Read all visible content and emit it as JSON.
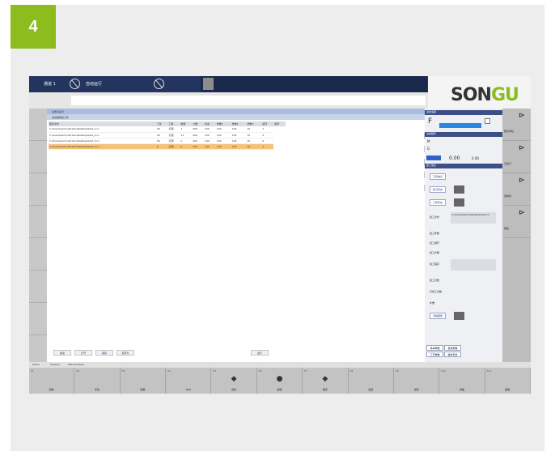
{
  "step": {
    "number": "4"
  },
  "topbar": {
    "channel": "通道 1",
    "mode": "自动运行"
  },
  "logo": {
    "text_main": "SON",
    "text_accent": "GU"
  },
  "panel": {
    "title": "注册表运行",
    "subtitle": "在线编辑加工件"
  },
  "table": {
    "headers": [
      "程序文件",
      "工件",
      "刀具",
      "数量",
      "计数",
      "状态",
      "参数1",
      "参数2",
      "参数3",
      "循环",
      "编号"
    ],
    "rows": [
      [
        "C:\\Users\\administrator\\Desktop\\test_1.nc",
        "36",
        "打磨",
        "1",
        "400",
        "100",
        "100",
        "100",
        "10",
        "1"
      ],
      [
        "C:\\Users\\administrator\\Desktop\\test_2.nc",
        "36",
        "打磨",
        "11",
        "400",
        "100",
        "100",
        "100",
        "10",
        "0"
      ],
      [
        "C:\\Users\\administrator\\Desktop\\test_3.nc",
        "36",
        "打磨",
        "0",
        "400",
        "100",
        "100",
        "100",
        "10",
        "0"
      ],
      [
        "C:\\Users\\administrator\\Desktop\\test_4.nc",
        "6",
        "打磨",
        "0",
        "400",
        "100",
        "100",
        "100",
        "10",
        "1"
      ]
    ]
  },
  "side_buttons": [
    "加载",
    "删除",
    "编辑",
    "上移",
    "下移"
  ],
  "bottom_buttons": [
    "新建",
    "打开",
    "保存",
    "另存为",
    "运行"
  ],
  "right_panel": {
    "header_a": "进给速度",
    "header_b": "当前程序",
    "header_c": "加工信息",
    "feed_letter": "F",
    "axis_m": "M",
    "axis_g": "G",
    "value_a": "0.00",
    "value_b": "0.00",
    "buttons": [
      "刀具信息",
      "换刀状态",
      "工件状态",
      "清除报警"
    ],
    "fields": [
      "加工文件",
      "加工件数",
      "加工循环",
      "加工步骤",
      "加工程序",
      "加工次数",
      "已加工次数",
      "补偿"
    ],
    "file_value": "C:\\Users\\admin\\Desktop\\test.nc",
    "tabs": [
      "基本参数",
      "机床参数",
      "工艺参数",
      "操作日志"
    ]
  },
  "far_right": [
    "程序单段",
    "空运行",
    "选择停",
    "跳段"
  ],
  "statusbar": [
    "Alarm",
    "Save(S)",
    "Manual Mode"
  ],
  "softkeys": [
    "回参",
    "手动",
    "增量",
    "MDI",
    "自动",
    "编辑",
    "程序",
    "设置",
    "诊断",
    "参数",
    "报警"
  ]
}
